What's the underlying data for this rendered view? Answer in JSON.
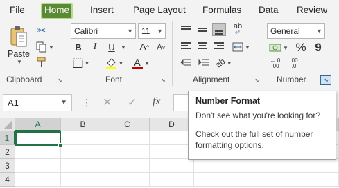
{
  "tabs": [
    {
      "label": "File"
    },
    {
      "label": "Home"
    },
    {
      "label": "Insert"
    },
    {
      "label": "Page Layout"
    },
    {
      "label": "Formulas"
    },
    {
      "label": "Data"
    },
    {
      "label": "Review"
    }
  ],
  "active_tab": "Home",
  "ribbon": {
    "clipboard": {
      "label": "Clipboard",
      "paste_label": "Paste"
    },
    "font": {
      "label": "Font",
      "font_name": "Calibri",
      "font_size": "11",
      "bold": "B",
      "italic": "I",
      "underline": "U",
      "grow": "A",
      "shrink": "A",
      "font_color_letter": "A",
      "highlight_color": "#ffff00",
      "font_color": "#c00000"
    },
    "alignment": {
      "label": "Alignment",
      "wrap_glyph": "ab"
    },
    "number": {
      "label": "Number",
      "format_value": "General",
      "currency_glyph": "$",
      "percent_glyph": "%",
      "comma_glyph": "9",
      "inc_decimal": ".00",
      "dec_decimal": ".0"
    }
  },
  "formula_bar": {
    "name_box": "A1",
    "fx_label": "fx",
    "cancel_glyph": "✕",
    "enter_glyph": "✓",
    "value": ""
  },
  "grid": {
    "columns": [
      "A",
      "B",
      "C",
      "D"
    ],
    "rows": [
      "1",
      "2",
      "3",
      "4"
    ],
    "active_cell": "A1"
  },
  "tooltip": {
    "title": "Number Format",
    "line1": "Don't see what you're looking for?",
    "body": "Check out the full set of number formatting options."
  },
  "colors": {
    "accent": "#217346",
    "active_tab": "#5b8a34"
  }
}
